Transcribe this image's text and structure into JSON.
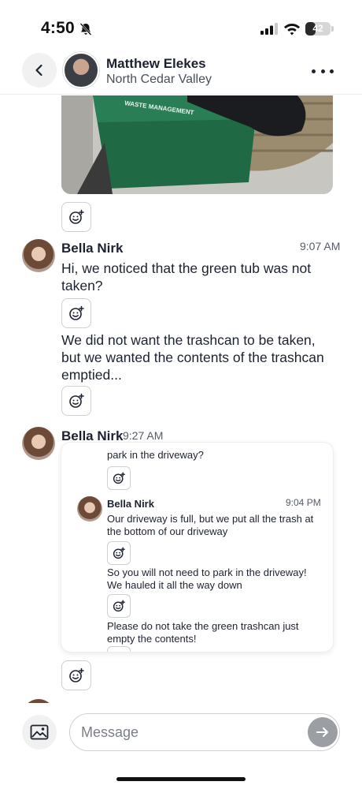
{
  "status_bar": {
    "time": "4:50",
    "battery": "42",
    "battery_level": 0.42
  },
  "header": {
    "name": "Matthew Elekes",
    "subtitle": "North Cedar Valley",
    "photo_text": "WASTE MANAGEMENT"
  },
  "messages": [
    {
      "sender": "Bella Nirk",
      "time": "9:07 AM",
      "paragraphs": [
        "Hi, we noticed that the green tub was not taken?",
        "We did not want the trashcan to be taken, but we wanted the contents of the trashcan emptied..."
      ]
    },
    {
      "sender": "Bella Nirk",
      "time": "9:27 AM",
      "quoted": {
        "partial_top": "park in the driveway?",
        "sender": "Bella Nirk",
        "time": "9:04 PM",
        "paragraphs": [
          "Our driveway is full, but we put all the trash at the bottom of our driveway",
          "So you will not need to park in the driveway! We hauled it all the way down",
          "Please do not take the green trashcan just empty the contents!"
        ]
      }
    }
  ],
  "composer": {
    "placeholder": "Message"
  },
  "icons": {
    "back": "chevron-left-icon",
    "more": "more-horizontal-icon",
    "reaction": "add-reaction-icon",
    "image": "image-icon",
    "send": "arrow-right-icon"
  },
  "colors": {
    "text": "#1d2230",
    "muted": "#565b66",
    "send_bg": "#9b9ea3"
  }
}
